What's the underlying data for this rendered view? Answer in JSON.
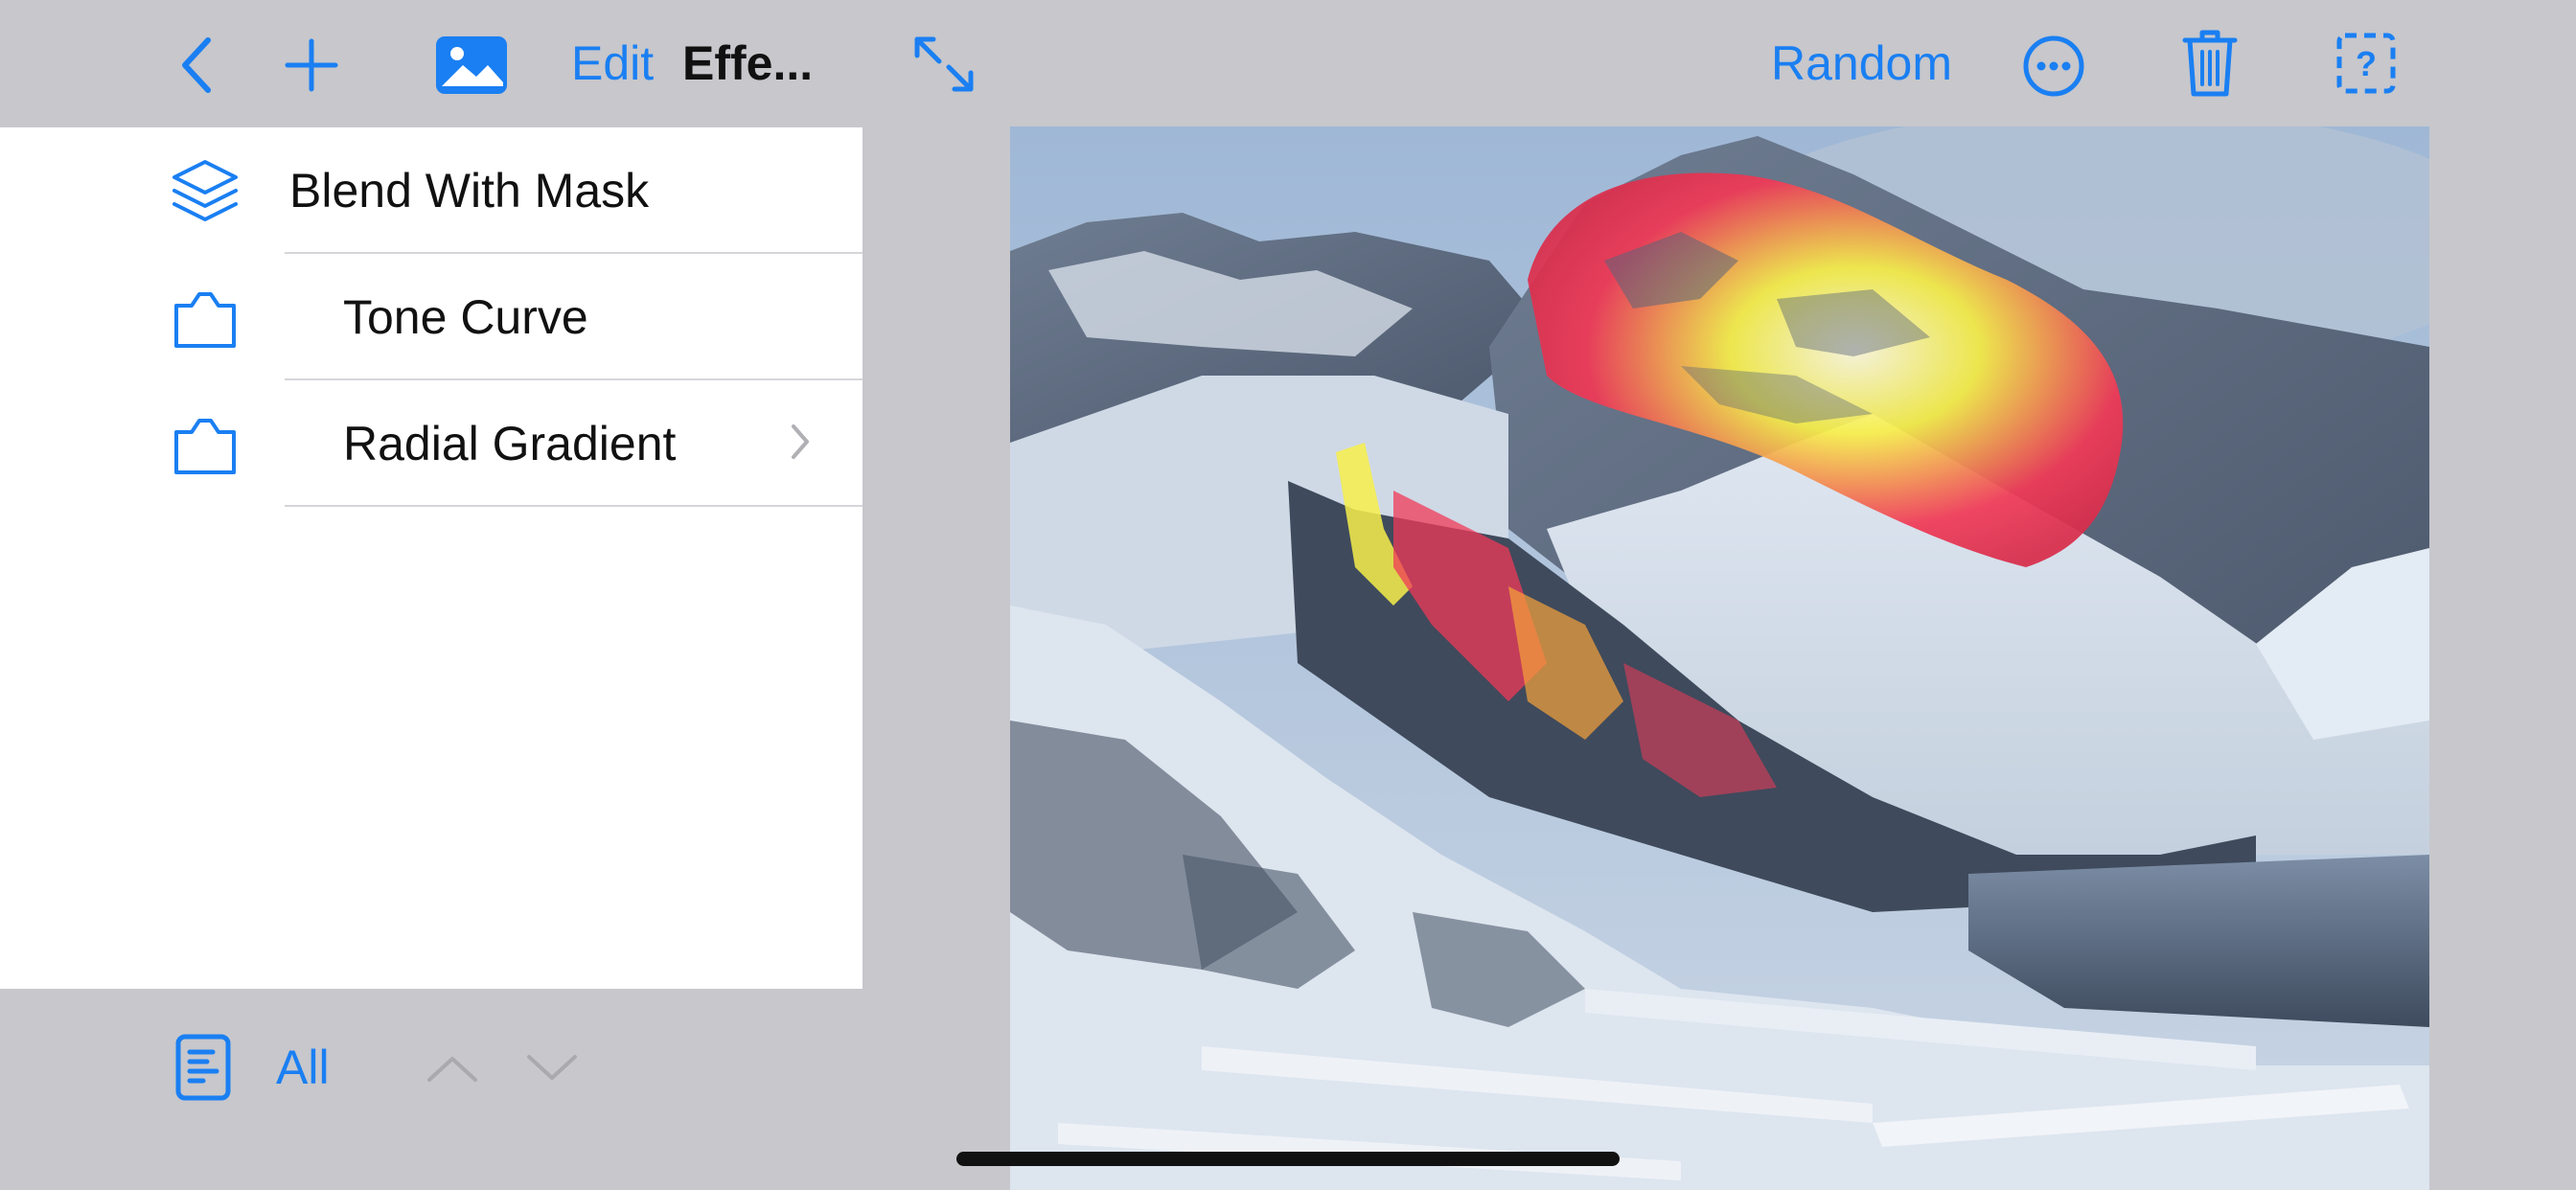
{
  "toolbar": {
    "back_icon": "chevron-left-icon",
    "add_icon": "plus-icon",
    "image_icon": "photo-icon",
    "edit_label": "Edit",
    "title": "Effe...",
    "expand_icon": "arrows-expand-icon",
    "random_label": "Random",
    "more_icon": "ellipsis-circle-icon",
    "trash_icon": "trash-icon",
    "help_icon": "dashed-question-icon"
  },
  "effects_list": [
    {
      "label": "Blend With Mask",
      "icon": "layers-icon",
      "indent": 0,
      "has_chevron": false
    },
    {
      "label": "Tone Curve",
      "icon": "tag-square-icon",
      "indent": 1,
      "has_chevron": false
    },
    {
      "label": "Radial Gradient",
      "icon": "tag-square-icon",
      "indent": 1,
      "has_chevron": true
    }
  ],
  "bottom_bar": {
    "doc_icon": "document-list-icon",
    "filter_label": "All",
    "up_icon": "chevron-up-icon",
    "down_icon": "chevron-down-icon"
  },
  "colors": {
    "accent": "#1a7ff2",
    "background": "#c7c7cc",
    "panel": "#ffffff"
  }
}
